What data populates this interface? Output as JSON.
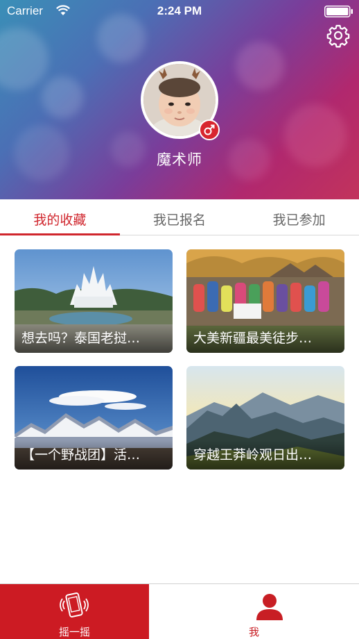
{
  "status_bar": {
    "carrier": "Carrier",
    "time": "2:24 PM",
    "wifi_icon": "wifi-icon",
    "battery_icon": "battery-icon"
  },
  "profile": {
    "username": "魔术师",
    "gender_icon": "male-icon",
    "settings_icon": "gear-icon"
  },
  "tabs": [
    {
      "label": "我的收藏",
      "active": true
    },
    {
      "label": "我已报名",
      "active": false
    },
    {
      "label": "我已参加",
      "active": false
    }
  ],
  "cards": [
    {
      "title": "想去吗？泰国老挝…"
    },
    {
      "title": "大美新疆最美徒步…"
    },
    {
      "title": "【一个野战团】活…"
    },
    {
      "title": "穿越王莽岭观日出…"
    }
  ],
  "tabbar": {
    "items": [
      {
        "label": "摇一摇",
        "icon": "phone-shake-icon",
        "active": true
      },
      {
        "label": "我",
        "icon": "person-icon",
        "active": false
      }
    ]
  },
  "colors": {
    "accent": "#d0262d",
    "tabbar_active_bg": "#cc1b23"
  }
}
